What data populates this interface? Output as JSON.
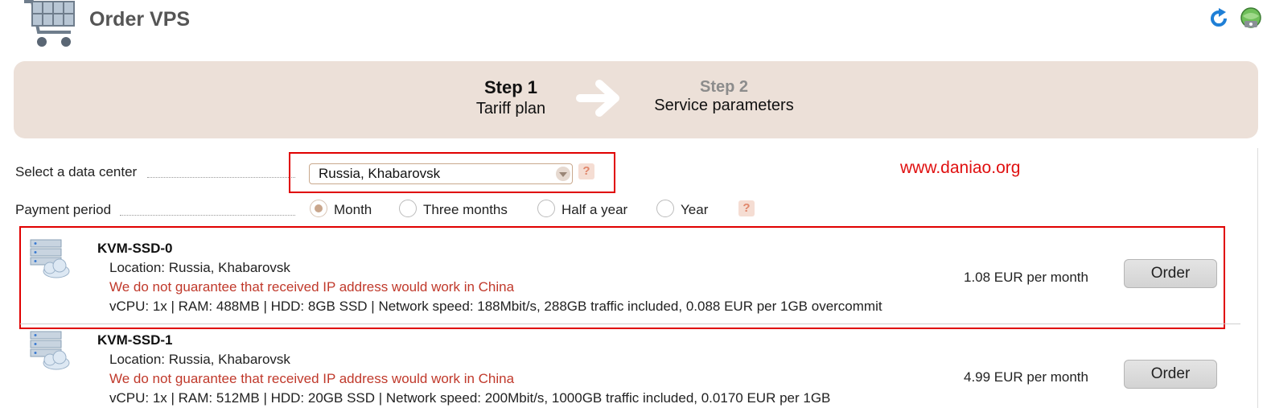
{
  "header": {
    "title": "Order VPS",
    "cart_icon": "shopping-cart-icon",
    "refresh_icon": "refresh-icon",
    "globe_icon": "globe-icon"
  },
  "steps": {
    "step1_title": "Step 1",
    "step1_sub": "Tariff plan",
    "step2_title": "Step 2",
    "step2_sub": "Service parameters"
  },
  "form": {
    "datacenter_label": "Select a data center",
    "datacenter_value": "Russia, Khabarovsk",
    "period_label": "Payment period",
    "help_text": "?",
    "periods": [
      {
        "label": "Month",
        "selected": true
      },
      {
        "label": "Three months",
        "selected": false
      },
      {
        "label": "Half a year",
        "selected": false
      },
      {
        "label": "Year",
        "selected": false
      }
    ]
  },
  "watermark": "www.daniao.org",
  "plans": [
    {
      "name": "KVM-SSD-0",
      "location": "Location: Russia, Khabarovsk",
      "warning": "We do not guarantee that received IP address would work in China",
      "specs": "vCPU: 1x | RAM: 488MB | HDD: 8GB SSD | Network speed: 188Mbit/s, 288GB traffic included, 0.088 EUR per 1GB overcommit",
      "price": "1.08 EUR per month",
      "order_label": "Order"
    },
    {
      "name": "KVM-SSD-1",
      "location": "Location: Russia, Khabarovsk",
      "warning": "We do not guarantee that received IP address would work in China",
      "specs": "vCPU: 1x | RAM: 512MB | HDD: 20GB SSD | Network speed: 200Mbit/s, 1000GB traffic included, 0.0170 EUR per 1GB",
      "price": "4.99 EUR per month",
      "order_label": "Order"
    }
  ],
  "colors": {
    "banner": "#ece0d8",
    "highlight": "#e00000",
    "warning": "#c0392b",
    "watermark": "#e01010"
  }
}
